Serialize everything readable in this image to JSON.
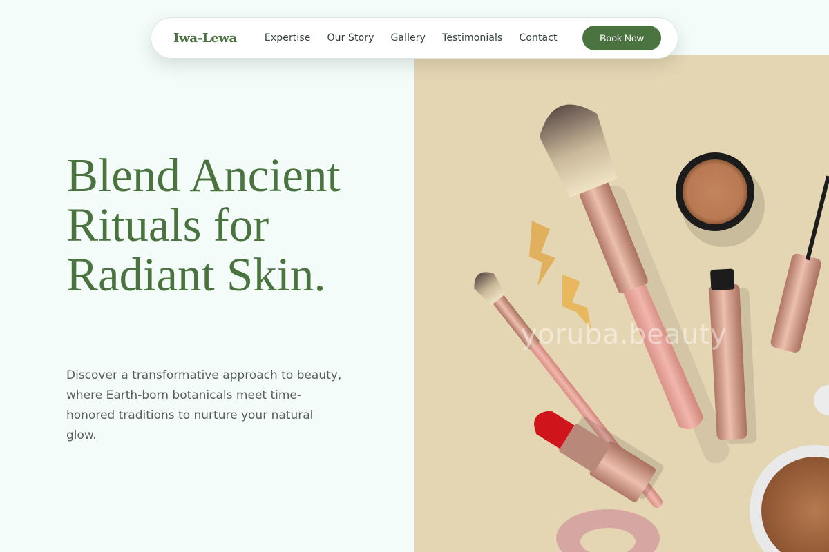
{
  "nav": {
    "logo": "Iwa-Lewa",
    "links": [
      "Expertise",
      "Our Story",
      "Gallery",
      "Testimonials",
      "Contact"
    ],
    "cta": "Book Now"
  },
  "hero": {
    "title": "Blend Ancient Rituals for Radiant Skin.",
    "description": "Discover a transformative approach to beauty, where Earth-born botanicals meet time-honored traditions to nurture your natural glow.",
    "image_watermark": "yoruba.beauty"
  },
  "colors": {
    "brand_green": "#4b7340",
    "page_background": "#f3fcf8",
    "image_background": "#e5d6b3",
    "body_text": "#56605b"
  },
  "icons": {
    "hero_image": "makeup-flatlay-photo"
  }
}
